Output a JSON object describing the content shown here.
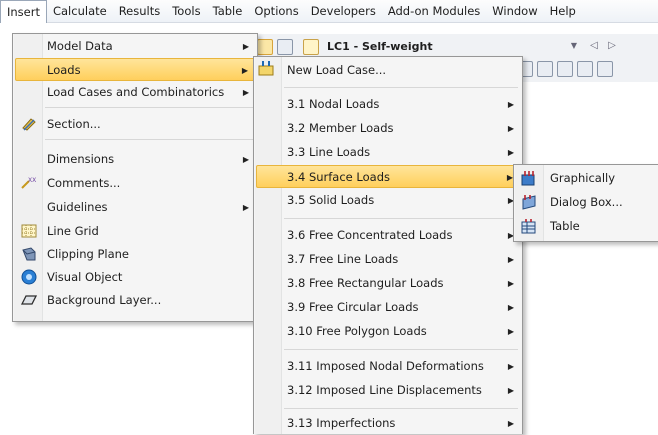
{
  "menubar": {
    "items": [
      "Insert",
      "Calculate",
      "Results",
      "Tools",
      "Table",
      "Options",
      "Developers",
      "Add-on Modules",
      "Window",
      "Help"
    ]
  },
  "toolbar": {
    "load_case": "LC1 - Self-weight"
  },
  "insert_menu": {
    "items": [
      {
        "label": "Model Data",
        "icon": "",
        "submenu": true
      },
      {
        "label": "Loads",
        "icon": "",
        "submenu": true
      },
      {
        "label": "Load Cases and Combinatorics",
        "icon": "",
        "submenu": true
      },
      {
        "label": "Section...",
        "icon": "section-icon",
        "submenu": false
      },
      {
        "label": "Dimensions",
        "icon": "",
        "submenu": true
      },
      {
        "label": "Comments...",
        "icon": "comments-icon",
        "submenu": false
      },
      {
        "label": "Guidelines",
        "icon": "",
        "submenu": true
      },
      {
        "label": "Line Grid",
        "icon": "line-grid-icon",
        "submenu": false
      },
      {
        "label": "Clipping Plane",
        "icon": "clipping-plane-icon",
        "submenu": false
      },
      {
        "label": "Visual Object",
        "icon": "visual-object-icon",
        "submenu": false
      },
      {
        "label": "Background Layer...",
        "icon": "background-layer-icon",
        "submenu": false
      }
    ]
  },
  "loads_menu": {
    "items": [
      {
        "label": "New Load Case...",
        "icon": "new-load-case-icon",
        "submenu": false
      },
      {
        "label": "3.1 Nodal Loads",
        "submenu": true
      },
      {
        "label": "3.2 Member Loads",
        "submenu": true
      },
      {
        "label": "3.3 Line Loads",
        "submenu": true
      },
      {
        "label": "3.4 Surface Loads",
        "submenu": true
      },
      {
        "label": "3.5 Solid Loads",
        "submenu": true
      },
      {
        "label": "3.6 Free Concentrated Loads",
        "submenu": true
      },
      {
        "label": "3.7 Free Line Loads",
        "submenu": true
      },
      {
        "label": "3.8 Free Rectangular Loads",
        "submenu": true
      },
      {
        "label": "3.9 Free Circular Loads",
        "submenu": true
      },
      {
        "label": "3.10 Free Polygon Loads",
        "submenu": true
      },
      {
        "label": "3.11 Imposed Nodal Deformations",
        "submenu": true
      },
      {
        "label": "3.12 Imposed Line Displacements",
        "submenu": true
      },
      {
        "label": "3.13 Imperfections",
        "submenu": true
      }
    ]
  },
  "surface_loads_menu": {
    "items": [
      {
        "label": "Graphically",
        "icon": "graphically-icon"
      },
      {
        "label": "Dialog Box...",
        "icon": "dialog-box-icon"
      },
      {
        "label": "Table",
        "icon": "table-icon"
      }
    ]
  },
  "colors": {
    "highlight": "#ffd66e",
    "menu_bg": "#f5f5f5"
  }
}
